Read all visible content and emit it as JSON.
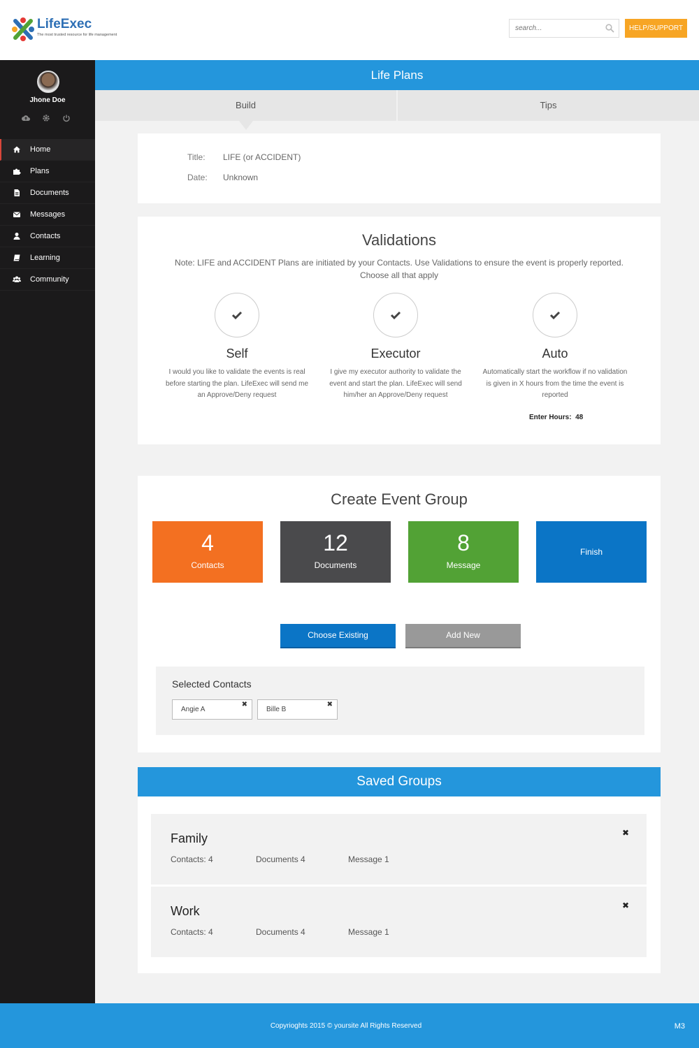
{
  "brand": {
    "name": "LifeExec",
    "tagline": "The most trusted resource for life management"
  },
  "search": {
    "placeholder": "search..."
  },
  "header": {
    "help_label": "HELP/SUPPORT"
  },
  "user": {
    "name": "Jhone Doe"
  },
  "sidebar": {
    "items": [
      {
        "label": "Home",
        "icon": "home-icon"
      },
      {
        "label": "Plans",
        "icon": "puzzle-icon"
      },
      {
        "label": "Documents",
        "icon": "document-icon"
      },
      {
        "label": "Messages",
        "icon": "envelope-icon"
      },
      {
        "label": "Contacts",
        "icon": "user-icon"
      },
      {
        "label": "Learning",
        "icon": "book-icon"
      },
      {
        "label": "Community",
        "icon": "users-icon"
      }
    ]
  },
  "page": {
    "title": "Life Plans",
    "tabs": [
      "Build",
      "Tips"
    ]
  },
  "plan": {
    "title_label": "Title:",
    "title_value": "LIFE (or ACCIDENT)",
    "date_label": "Date:",
    "date_value": "Unknown"
  },
  "validations": {
    "heading": "Validations",
    "note_line1": "Note: LIFE and ACCIDENT Plans are initiated by your Contacts. Use Validations to ensure the event is properly reported.",
    "note_line2": "Choose all that apply",
    "options": [
      {
        "name": "Self",
        "desc": "I would you like to validate the events is real before starting the plan. LifeExec will send me an Approve/Deny request"
      },
      {
        "name": "Executor",
        "desc": "I give my executor authority to validate the event and start the plan. LifeExec will send him/her an Approve/Deny request"
      },
      {
        "name": "Auto",
        "desc": "Automatically start the workflow if no validation is given in X hours from the time the event is reported"
      }
    ],
    "hours_label": "Enter Hours:",
    "hours_value": "48"
  },
  "event_group": {
    "heading": "Create Event Group",
    "tiles": [
      {
        "num": "4",
        "label": "Contacts"
      },
      {
        "num": "12",
        "label": "Documents"
      },
      {
        "num": "8",
        "label": "Message"
      },
      {
        "num": "",
        "label": "Finish"
      }
    ],
    "choose_label": "Choose Existing",
    "add_label": "Add New",
    "selected_title": "Selected Contacts",
    "chips": [
      "Angie A",
      "Bille B"
    ]
  },
  "saved": {
    "heading": "Saved Groups",
    "groups": [
      {
        "name": "Family",
        "contacts": "Contacts: 4",
        "documents": "Documents 4",
        "message": "Message 1"
      },
      {
        "name": "Work",
        "contacts": "Contacts: 4",
        "documents": "Documents 4",
        "message": "Message 1"
      }
    ]
  },
  "footer": {
    "copyright": "Copyrioghts 2015 © yoursite All Rights Reserved",
    "version": "M3"
  },
  "colors": {
    "primary": "#2496dc",
    "orange": "#f37021",
    "dark": "#4a4a4c",
    "green": "#52a235",
    "finish": "#0b75c6",
    "help": "#f7a524",
    "sidebar": "#1b1a1b"
  }
}
